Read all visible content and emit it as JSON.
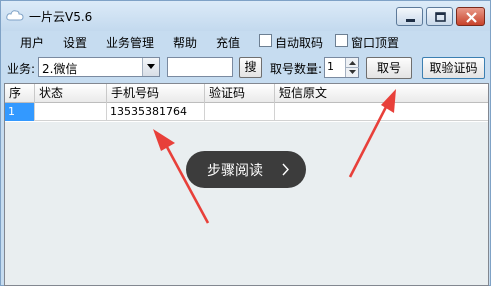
{
  "window": {
    "title": "一片云V5.6",
    "icon": "cloud-icon"
  },
  "controls": {
    "minimize_icon": "minimize-icon",
    "maximize_icon": "maximize-icon",
    "close_icon": "close-icon"
  },
  "menu": {
    "items": [
      "用户",
      "设置",
      "业务管理",
      "帮助",
      "充值"
    ],
    "checkboxes": [
      {
        "label": "自动取码",
        "checked": false
      },
      {
        "label": "窗口顶置",
        "checked": false
      }
    ]
  },
  "toolbar": {
    "service_label": "业务:",
    "service_value": "2.微信",
    "search_value": "",
    "search_button": "搜",
    "quantity_label": "取号数量:",
    "quantity_value": "1",
    "get_number_button": "取号",
    "get_code_button": "取验证码"
  },
  "table": {
    "columns": [
      "序",
      "状态",
      "手机号码",
      "验证码",
      "短信原文"
    ],
    "rows": [
      {
        "index": "1",
        "status": "",
        "phone": "13535381764",
        "code": "",
        "sms": ""
      }
    ]
  },
  "overlay": {
    "label": "步骤阅读",
    "chevron": "chevron-right-icon"
  },
  "colors": {
    "window_bg": "#c6dcf0",
    "selected_row": "#3399ff",
    "annotation_arrow": "#e8403a",
    "overlay_bg": "#2d2d2d"
  }
}
